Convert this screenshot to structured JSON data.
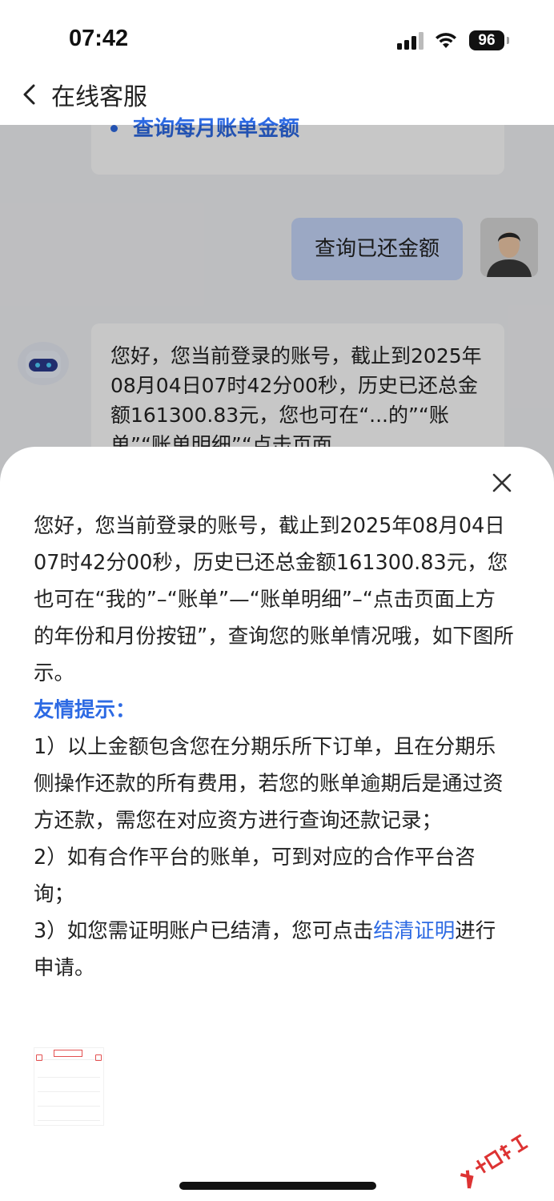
{
  "status": {
    "time": "07:42",
    "battery": "96"
  },
  "nav": {
    "title": "在线客服"
  },
  "chat": {
    "bullet_link": "查询每月账单金额",
    "user_message": "查询已还金额",
    "bot_message": "您好，您当前登录的账号，截止到2025年08月04日07时42分00秒，历史已还总金额161300.83元，您也可在“...的”“账单”“账单明细”“点击页面"
  },
  "sheet": {
    "intro": "您好，您当前登录的账号，截止到2025年08月04日07时42分00秒，历史已还总金额161300.83元，您也可在“我的”–“账单”—“账单明细”–“点击页面上方的年份和月份按钮”，查询您的账单情况哦，如下图所示。",
    "tip_title": "友情提示：",
    "tip1": "1）以上金额包含您在分期乐所下订单，且在分期乐侧操作还款的所有费用，若您的账单逾期后是通过资方还款，需您在对应资方进行查询还款记录；",
    "tip2": "2）如有合作平台的账单，可到对应的合作平台咨询；",
    "tip3_prefix": "3）如您需证明账户已结清，您可点击",
    "tip3_link": "结清证明",
    "tip3_suffix": "进行申请。"
  },
  "watermark": "卡农社区",
  "colors": {
    "accent": "#2d6ae3",
    "user_bubble": "#c7d8fb",
    "background": "#f3f4f6"
  }
}
